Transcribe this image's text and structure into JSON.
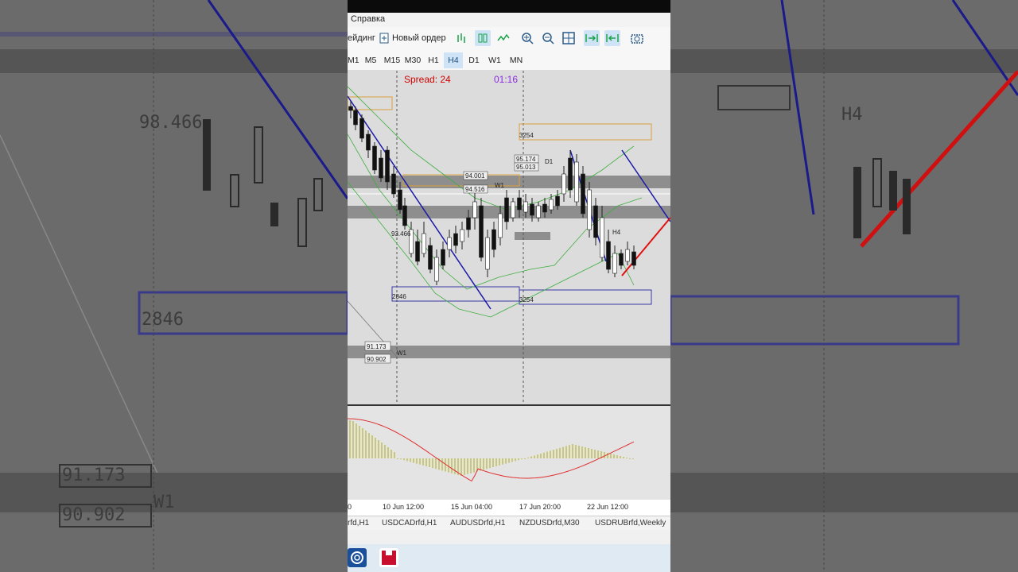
{
  "menu": {
    "help_label": "Справка"
  },
  "toolbar": {
    "trading_label": "ейдинг",
    "new_order_label": "Новый ордер"
  },
  "timeframes": [
    "M1",
    "M5",
    "M15",
    "M30",
    "H1",
    "H4",
    "D1",
    "W1",
    "MN"
  ],
  "active_timeframe": "H4",
  "chart": {
    "spread_label": "Spread: 24",
    "timer_label": "01:16",
    "price_labels": [
      "94.001",
      "94.516",
      "95.174",
      "95.013",
      "93.466",
      "91.173",
      "90.902",
      "3254",
      "2846",
      "D1",
      "W1",
      "H4"
    ],
    "time_axis": [
      "10 Jun 12:00",
      "15 Jun 04:00",
      "17 Jun 20:00",
      "22 Jun 12:00"
    ],
    "axis_left_partial": "0"
  },
  "symbols": [
    "rfd,H1",
    "USDCADrfd,H1",
    "AUDUSDrfd,H1",
    "NZDUSDrfd,M30",
    "USDRUBrfd,Weekly"
  ],
  "background_labels": [
    "98.466",
    "2846",
    "91.173",
    "90.902",
    "W1",
    "H4"
  ],
  "colors": {
    "down_trend": "#1a1aa8",
    "up_trend": "#e01010",
    "spread": "#d00000",
    "timer": "#8a2be2",
    "macd_bars": "#c8c878",
    "signal": "#e03030"
  },
  "icons": [
    "new-order-icon",
    "zoom-in-icon",
    "zoom-out-icon",
    "grid-icon",
    "screenshot-icon",
    "terminal-app-icon",
    "app-icon"
  ]
}
